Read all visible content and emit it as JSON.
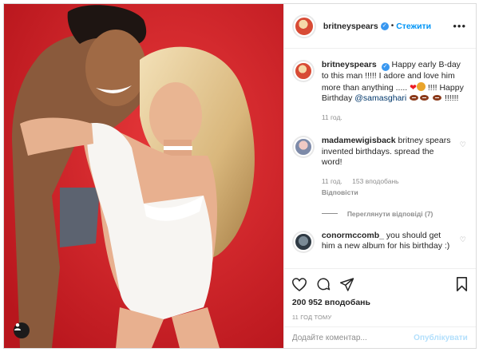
{
  "post": {
    "username": "britneyspears",
    "follow_label": "Стежити",
    "header_separator": "•",
    "more_label": "•••"
  },
  "caption": {
    "username": "britneyspears",
    "text_part1": "Happy early B-day to this man !!!!! I adore and love him more than anything .....",
    "text_part2": "!!!! Happy Birthday",
    "mention": "@samasghari",
    "text_part3": "!!!!!!",
    "time": "11 год."
  },
  "comments": [
    {
      "username": "madamewigisback",
      "text": "britney spears invented birthdays. spread the word!",
      "time": "11 год.",
      "likes": "153 вподобань",
      "reply_label": "Відповісти"
    },
    {
      "username": "conormccomb_",
      "text": "you should get him a new album for his birthday :)"
    }
  ],
  "view_replies_label": "Переглянути відповіді (7)",
  "likes_count": "200 952 вподобань",
  "timestamp": "11 ГОД ТОМУ",
  "composer": {
    "placeholder": "Додайте коментар...",
    "publish_label": "Опублікувати"
  },
  "icons": {
    "verified": "verified-badge-icon",
    "like": "heart-icon",
    "comment": "comment-icon",
    "share": "share-icon",
    "save": "bookmark-icon",
    "user_tag": "user-tag-icon"
  },
  "colors": {
    "accent": "#0095f6",
    "photo_background": "#d3272d",
    "verified": "#3897f0"
  }
}
